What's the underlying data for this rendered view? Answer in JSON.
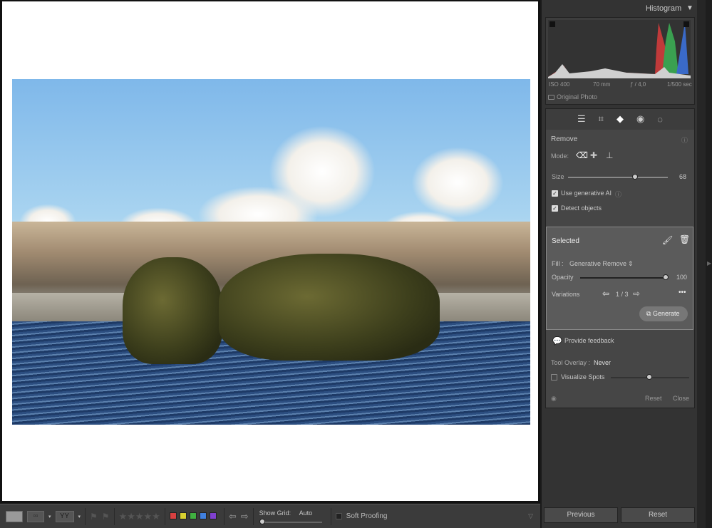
{
  "histogram": {
    "title": "Histogram",
    "iso": "ISO 400",
    "focal": "70 mm",
    "aperture": "ƒ / 4,0",
    "shutter": "1/500 sec",
    "original_photo": "Original Photo"
  },
  "tools": [
    "edit-icon",
    "crop-icon",
    "remove-icon",
    "red-eye-icon",
    "masking-icon"
  ],
  "remove": {
    "title": "Remove",
    "mode_label": "Mode:",
    "size_label": "Size",
    "size_value": "68",
    "size_fraction": 0.68,
    "use_gen_ai": "Use generative AI",
    "use_gen_ai_checked": true,
    "detect_objects": "Detect objects",
    "detect_objects_checked": true
  },
  "selected": {
    "title": "Selected",
    "fill_label": "Fill :",
    "fill_value": "Generative Remove",
    "opacity_label": "Opacity",
    "opacity_value": "100",
    "variations_label": "Variations",
    "variations_value": "1 / 3",
    "generate": "Generate"
  },
  "feedback": "Provide feedback",
  "tool_overlay": {
    "label": "Tool Overlay :",
    "value": "Never"
  },
  "visualize_spots": {
    "label": "Visualize Spots",
    "checked": false
  },
  "footer": {
    "reset": "Reset",
    "close": "Close"
  },
  "bottom_buttons": {
    "previous": "Previous",
    "reset": "Reset"
  },
  "toolbar": {
    "show_grid_label": "Show Grid:",
    "show_grid_value": "Auto",
    "soft_proofing": "Soft Proofing",
    "color_labels": [
      "#d84040",
      "#d8d030",
      "#40b040",
      "#4080e0",
      "#8040d0"
    ]
  }
}
